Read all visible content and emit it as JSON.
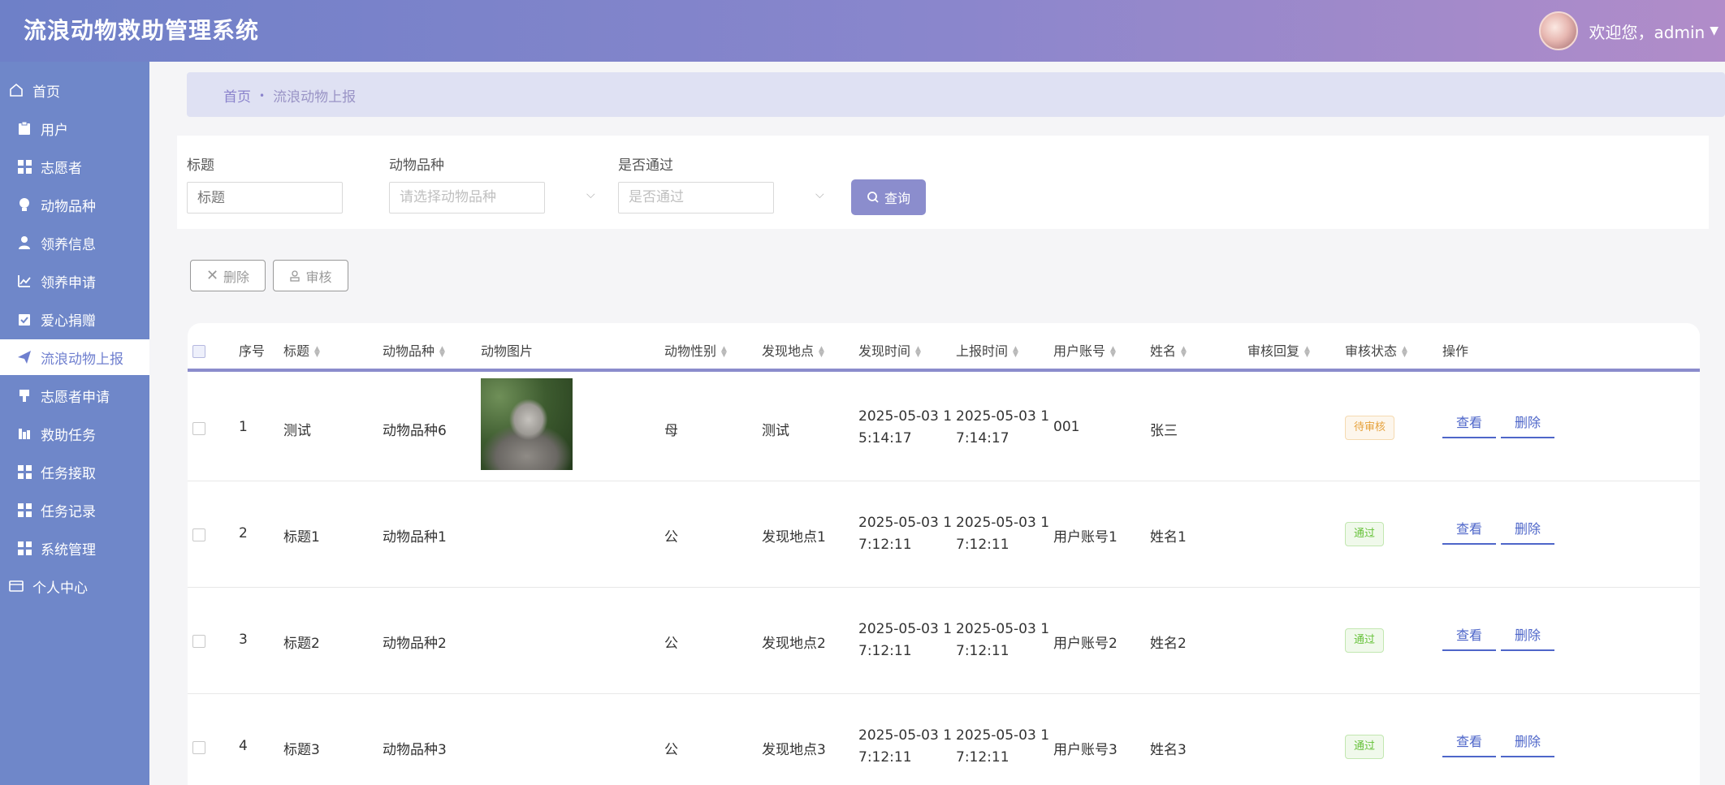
{
  "app": {
    "title": "流浪动物救助管理系统",
    "welcome": "欢迎您，admin"
  },
  "sidebar": {
    "items": [
      {
        "label": "首页",
        "icon": "home-icon"
      },
      {
        "label": "用户",
        "icon": "clipboard-icon"
      },
      {
        "label": "志愿者",
        "icon": "grid-icon"
      },
      {
        "label": "动物品种",
        "icon": "bulb-icon"
      },
      {
        "label": "领养信息",
        "icon": "person-icon"
      },
      {
        "label": "领养申请",
        "icon": "trend-icon"
      },
      {
        "label": "爱心捐赠",
        "icon": "clipboard-check-icon"
      },
      {
        "label": "流浪动物上报",
        "icon": "send-icon"
      },
      {
        "label": "志愿者申请",
        "icon": "cup-icon"
      },
      {
        "label": "救助任务",
        "icon": "chart-icon"
      },
      {
        "label": "任务接取",
        "icon": "grid-icon"
      },
      {
        "label": "任务记录",
        "icon": "grid-icon"
      },
      {
        "label": "系统管理",
        "icon": "grid-icon"
      },
      {
        "label": "个人中心",
        "icon": "wallet-icon"
      }
    ]
  },
  "breadcrumb": {
    "home": "首页",
    "current": "流浪动物上报"
  },
  "search": {
    "title_label": "标题",
    "title_placeholder": "标题",
    "breed_label": "动物品种",
    "breed_placeholder": "请选择动物品种",
    "pass_label": "是否通过",
    "pass_placeholder": "是否通过",
    "query_button": "查询"
  },
  "actions": {
    "delete": "删除",
    "review": "审核"
  },
  "table": {
    "headers": {
      "index": "序号",
      "title": "标题",
      "breed": "动物品种",
      "image": "动物图片",
      "gender": "动物性别",
      "location": "发现地点",
      "found_time": "发现时间",
      "report_time": "上报时间",
      "account": "用户账号",
      "name": "姓名",
      "reply": "审核回复",
      "status": "审核状态",
      "ops": "操作"
    },
    "rows": [
      {
        "index": "1",
        "title": "测试",
        "breed": "动物品种6",
        "has_image": true,
        "gender": "母",
        "location": "测试",
        "found_time_1": "2025-05-03 1",
        "found_time_2": "5:14:17",
        "report_time_1": "2025-05-03 1",
        "report_time_2": "7:14:17",
        "account": "001",
        "name": "张三",
        "status": "待审核",
        "status_type": "pending"
      },
      {
        "index": "2",
        "title": "标题1",
        "breed": "动物品种1",
        "has_image": false,
        "gender": "公",
        "location": "发现地点1",
        "found_time_1": "2025-05-03 1",
        "found_time_2": "7:12:11",
        "report_time_1": "2025-05-03 1",
        "report_time_2": "7:12:11",
        "account": "用户账号1",
        "name": "姓名1",
        "status": "通过",
        "status_type": "pass"
      },
      {
        "index": "3",
        "title": "标题2",
        "breed": "动物品种2",
        "has_image": false,
        "gender": "公",
        "location": "发现地点2",
        "found_time_1": "2025-05-03 1",
        "found_time_2": "7:12:11",
        "report_time_1": "2025-05-03 1",
        "report_time_2": "7:12:11",
        "account": "用户账号2",
        "name": "姓名2",
        "status": "通过",
        "status_type": "pass"
      },
      {
        "index": "4",
        "title": "标题3",
        "breed": "动物品种3",
        "has_image": false,
        "gender": "公",
        "location": "发现地点3",
        "found_time_1": "2025-05-03 1",
        "found_time_2": "7:12:11",
        "report_time_1": "2025-05-03 1",
        "report_time_2": "7:12:11",
        "account": "用户账号3",
        "name": "姓名3",
        "status": "通过",
        "status_type": "pass"
      }
    ],
    "view_label": "查看",
    "delete_label": "删除"
  }
}
